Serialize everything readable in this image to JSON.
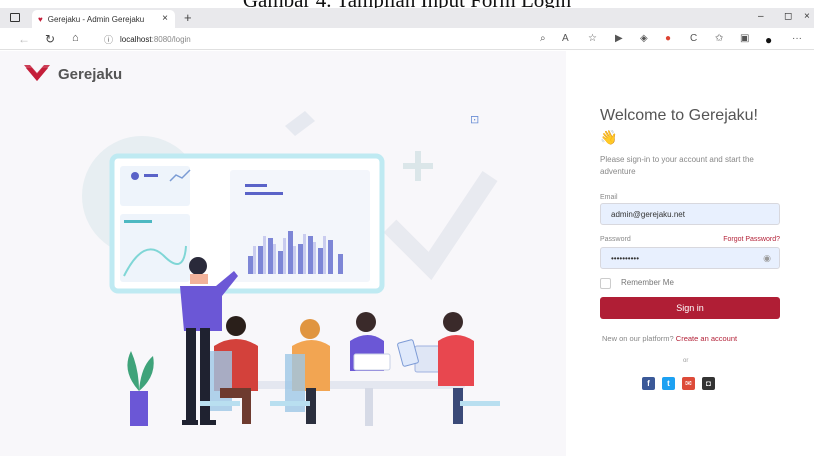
{
  "caption": "Gambar 4. Tampilan Input Form Login",
  "browser": {
    "tab_title": "Gerejaku - Admin Gerejaku",
    "tab_close": "×",
    "new_tab": "+",
    "url_host": "localhost",
    "url_rest": ":8080/login",
    "win_min": "–",
    "win_max": "◻",
    "win_close": "×"
  },
  "brand": {
    "name": "Gerejaku",
    "color": "#c41e3a"
  },
  "form": {
    "welcome": "Welcome to Gerejaku!",
    "wave_emoji": "👋",
    "subtitle": "Please sign-in to your account and start the adventure",
    "email_label": "Email",
    "email_value": "admin@gerejaku.net",
    "password_label": "Password",
    "forgot": "Forgot Password?",
    "password_value": "••••••••••",
    "remember": "Remember Me",
    "signin": "Sign in",
    "new_text": "New on our platform?",
    "create_account": "Create an account",
    "or": "or"
  },
  "social": [
    {
      "icon": "facebook-icon",
      "glyph": "f",
      "color": "#3b5998"
    },
    {
      "icon": "twitter-icon",
      "glyph": "t",
      "color": "#1da1f2"
    },
    {
      "icon": "mail-icon",
      "glyph": "✉",
      "color": "#dd4b39"
    },
    {
      "icon": "github-icon",
      "glyph": "◘",
      "color": "#333333"
    }
  ],
  "colors": {
    "accent": "#b01e35",
    "input_bg": "#e8f0fe",
    "left_bg": "#f8f7fa"
  }
}
